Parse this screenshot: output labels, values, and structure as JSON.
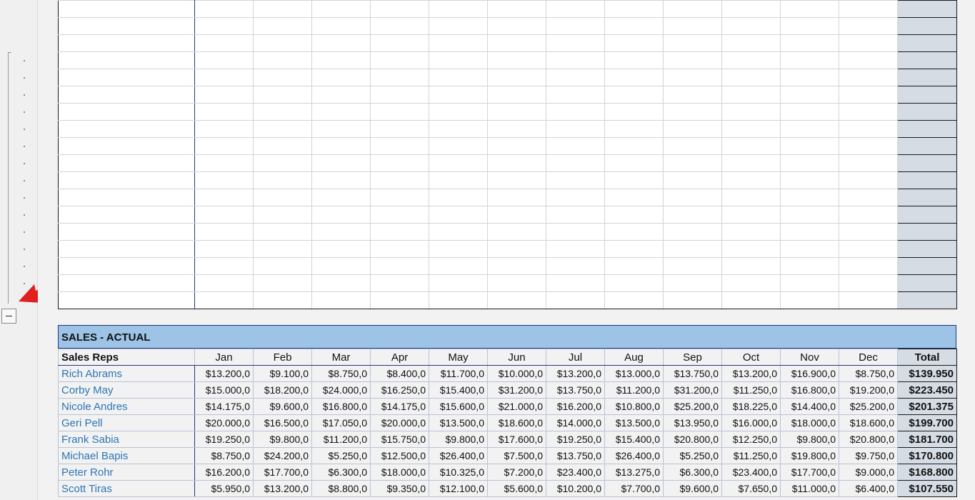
{
  "sales_table": {
    "title": "SALES - ACTUAL",
    "rep_header": "Sales Reps",
    "months": [
      "Jan",
      "Feb",
      "Mar",
      "Apr",
      "May",
      "Jun",
      "Jul",
      "Aug",
      "Sep",
      "Oct",
      "Nov",
      "Dec"
    ],
    "total_header": "Total",
    "rows": [
      {
        "rep": "Rich Abrams",
        "values": [
          "$13.200,0",
          "$9.100,0",
          "$8.750,0",
          "$8.400,0",
          "$11.700,0",
          "$10.000,0",
          "$13.200,0",
          "$13.000,0",
          "$13.750,0",
          "$13.200,0",
          "$16.900,0",
          "$8.750,0"
        ],
        "total": "$139.950"
      },
      {
        "rep": "Corby May",
        "values": [
          "$15.000,0",
          "$18.200,0",
          "$24.000,0",
          "$16.250,0",
          "$15.400,0",
          "$31.200,0",
          "$13.750,0",
          "$11.200,0",
          "$31.200,0",
          "$11.250,0",
          "$16.800,0",
          "$19.200,0"
        ],
        "total": "$223.450"
      },
      {
        "rep": "Nicole Andres",
        "values": [
          "$14.175,0",
          "$9.600,0",
          "$16.800,0",
          "$14.175,0",
          "$15.600,0",
          "$21.000,0",
          "$16.200,0",
          "$10.800,0",
          "$25.200,0",
          "$18.225,0",
          "$14.400,0",
          "$25.200,0"
        ],
        "total": "$201.375"
      },
      {
        "rep": "Geri Pell",
        "values": [
          "$20.000,0",
          "$16.500,0",
          "$17.050,0",
          "$20.000,0",
          "$13.500,0",
          "$18.600,0",
          "$14.000,0",
          "$13.500,0",
          "$13.950,0",
          "$16.000,0",
          "$18.000,0",
          "$18.600,0"
        ],
        "total": "$199.700"
      },
      {
        "rep": "Frank Sabia",
        "values": [
          "$19.250,0",
          "$9.800,0",
          "$11.200,0",
          "$15.750,0",
          "$9.800,0",
          "$17.600,0",
          "$19.250,0",
          "$15.400,0",
          "$20.800,0",
          "$12.250,0",
          "$9.800,0",
          "$20.800,0"
        ],
        "total": "$181.700"
      },
      {
        "rep": "Michael Bapis",
        "values": [
          "$8.750,0",
          "$24.200,0",
          "$5.250,0",
          "$12.500,0",
          "$26.400,0",
          "$7.500,0",
          "$13.750,0",
          "$26.400,0",
          "$5.250,0",
          "$11.250,0",
          "$19.800,0",
          "$9.750,0"
        ],
        "total": "$170.800"
      },
      {
        "rep": "Peter Rohr",
        "values": [
          "$16.200,0",
          "$17.700,0",
          "$6.300,0",
          "$18.000,0",
          "$10.325,0",
          "$7.200,0",
          "$23.400,0",
          "$13.275,0",
          "$6.300,0",
          "$23.400,0",
          "$17.700,0",
          "$9.000,0"
        ],
        "total": "$168.800"
      },
      {
        "rep": "Scott Tiras",
        "values": [
          "$5.950,0",
          "$13.200,0",
          "$8.800,0",
          "$9.350,0",
          "$12.100,0",
          "$5.600,0",
          "$10.200,0",
          "$7.700,0",
          "$9.600,0",
          "$7.650,0",
          "$11.000,0",
          "$6.400,0"
        ],
        "total": "$107.550"
      }
    ]
  },
  "outline": {
    "collapse_icon": "minus-icon",
    "annotation_icon": "red-arrow-icon",
    "arrow_color": "#e0201e"
  },
  "colors": {
    "header_band": "#9dc3e6",
    "total_column": "#d6dce4",
    "rep_name": "#2e75b6"
  }
}
